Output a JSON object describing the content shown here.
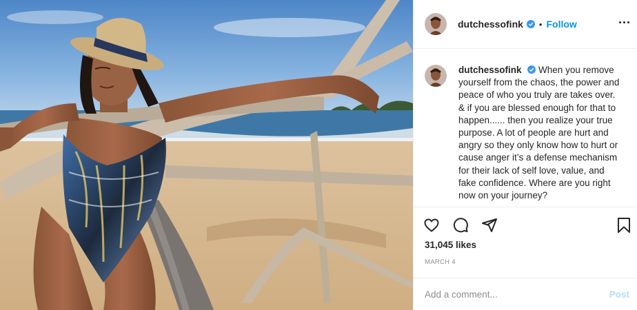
{
  "post": {
    "username": "dutchessofink",
    "verified": true,
    "separator": "•",
    "follow_label": "Follow",
    "caption": "When you remove yourself from the chaos, the power and peace of who you truly are takes over. & if you are blessed enough for that to happen...... then you realize your true purpose. A lot of people are hurt and angry so they only know how to hurt or cause anger it’s a defense mechanism for their lack of self love, value, and fake confidence. Where are you right now on your journey?",
    "likes": "31,045 likes",
    "date": "MARCH 4"
  },
  "comment": {
    "placeholder": "Add a comment...",
    "post_label": "Post"
  },
  "icons": [
    "heart-icon",
    "comment-icon",
    "share-icon",
    "bookmark-icon",
    "more-options-icon",
    "verified-badge-icon"
  ],
  "colors": {
    "accent": "#0095f6",
    "post_disabled": "#b2dffc",
    "verified_badge": "#3897f0",
    "text_primary": "#262626",
    "text_secondary": "#8e8e8e"
  }
}
